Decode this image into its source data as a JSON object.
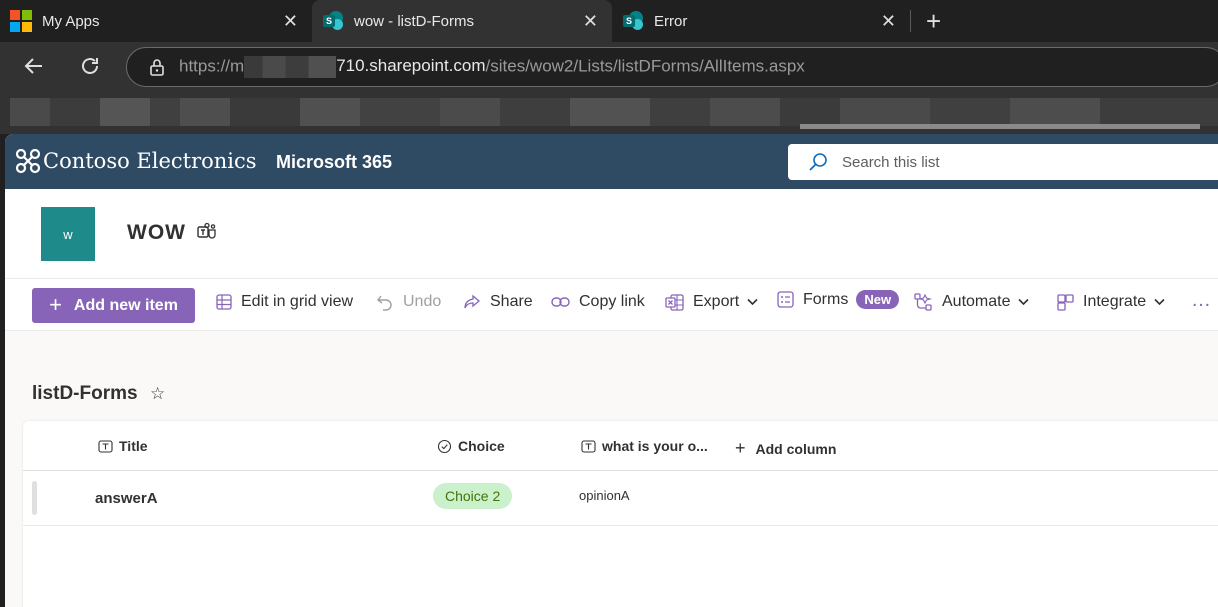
{
  "browser": {
    "tabs": [
      {
        "title": "My Apps",
        "icon": "microsoft-logo-icon",
        "active": false
      },
      {
        "title": "wow - listD-Forms",
        "icon": "sharepoint-icon",
        "active": true
      },
      {
        "title": "Error",
        "icon": "sharepoint-icon",
        "active": false
      }
    ],
    "url_prefix": "https://m",
    "url_host_rest": "710.sharepoint.com",
    "url_path": "/sites/wow2/Lists/listDForms/AllItems.aspx"
  },
  "suite": {
    "brand": "Contoso Electronics",
    "app": "Microsoft 365",
    "search_placeholder": "Search this list"
  },
  "site": {
    "logo_letter": "w",
    "title": "WOW"
  },
  "commands": {
    "add_new_item": "Add new item",
    "edit_grid": "Edit in grid view",
    "undo": "Undo",
    "share": "Share",
    "copy_link": "Copy link",
    "export": "Export",
    "forms": "Forms",
    "forms_badge": "New",
    "automate": "Automate",
    "integrate": "Integrate",
    "more": "…"
  },
  "list": {
    "title": "listD-Forms",
    "columns": {
      "title": "Title",
      "choice": "Choice",
      "opinion": "what is your o...",
      "add": "Add column"
    },
    "rows": [
      {
        "title": "answerA",
        "choice": "Choice 2",
        "opinion": "opinionA"
      }
    ]
  },
  "colors": {
    "suitebar": "#2f4a63",
    "accent": "#8764b8",
    "site_logo": "#1e8a89",
    "choice_pill_bg": "#caf0cc"
  }
}
